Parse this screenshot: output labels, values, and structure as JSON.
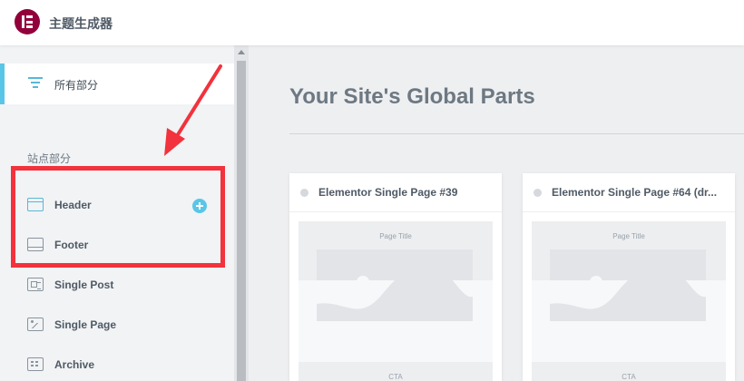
{
  "app": {
    "title": "主题生成器"
  },
  "sidebar": {
    "all_parts": "所有部分",
    "section_label": "站点部分",
    "items": [
      {
        "label": "Header",
        "icon": "header-icon"
      },
      {
        "label": "Footer",
        "icon": "footer-icon"
      },
      {
        "label": "Single Post",
        "icon": "single-post-icon"
      },
      {
        "label": "Single Page",
        "icon": "single-page-icon"
      },
      {
        "label": "Archive",
        "icon": "archive-icon"
      }
    ]
  },
  "main": {
    "title": "Your Site's Global Parts",
    "cards": [
      {
        "title": "Elementor Single Page #39",
        "preview_title": "Page Title",
        "preview_cta": "CTA"
      },
      {
        "title": "Elementor Single Page #64 (dr...",
        "preview_title": "Page Title",
        "preview_cta": "CTA"
      }
    ]
  },
  "colors": {
    "brand": "#92003b",
    "accent": "#59c6e8",
    "annotation": "#f2323c"
  }
}
